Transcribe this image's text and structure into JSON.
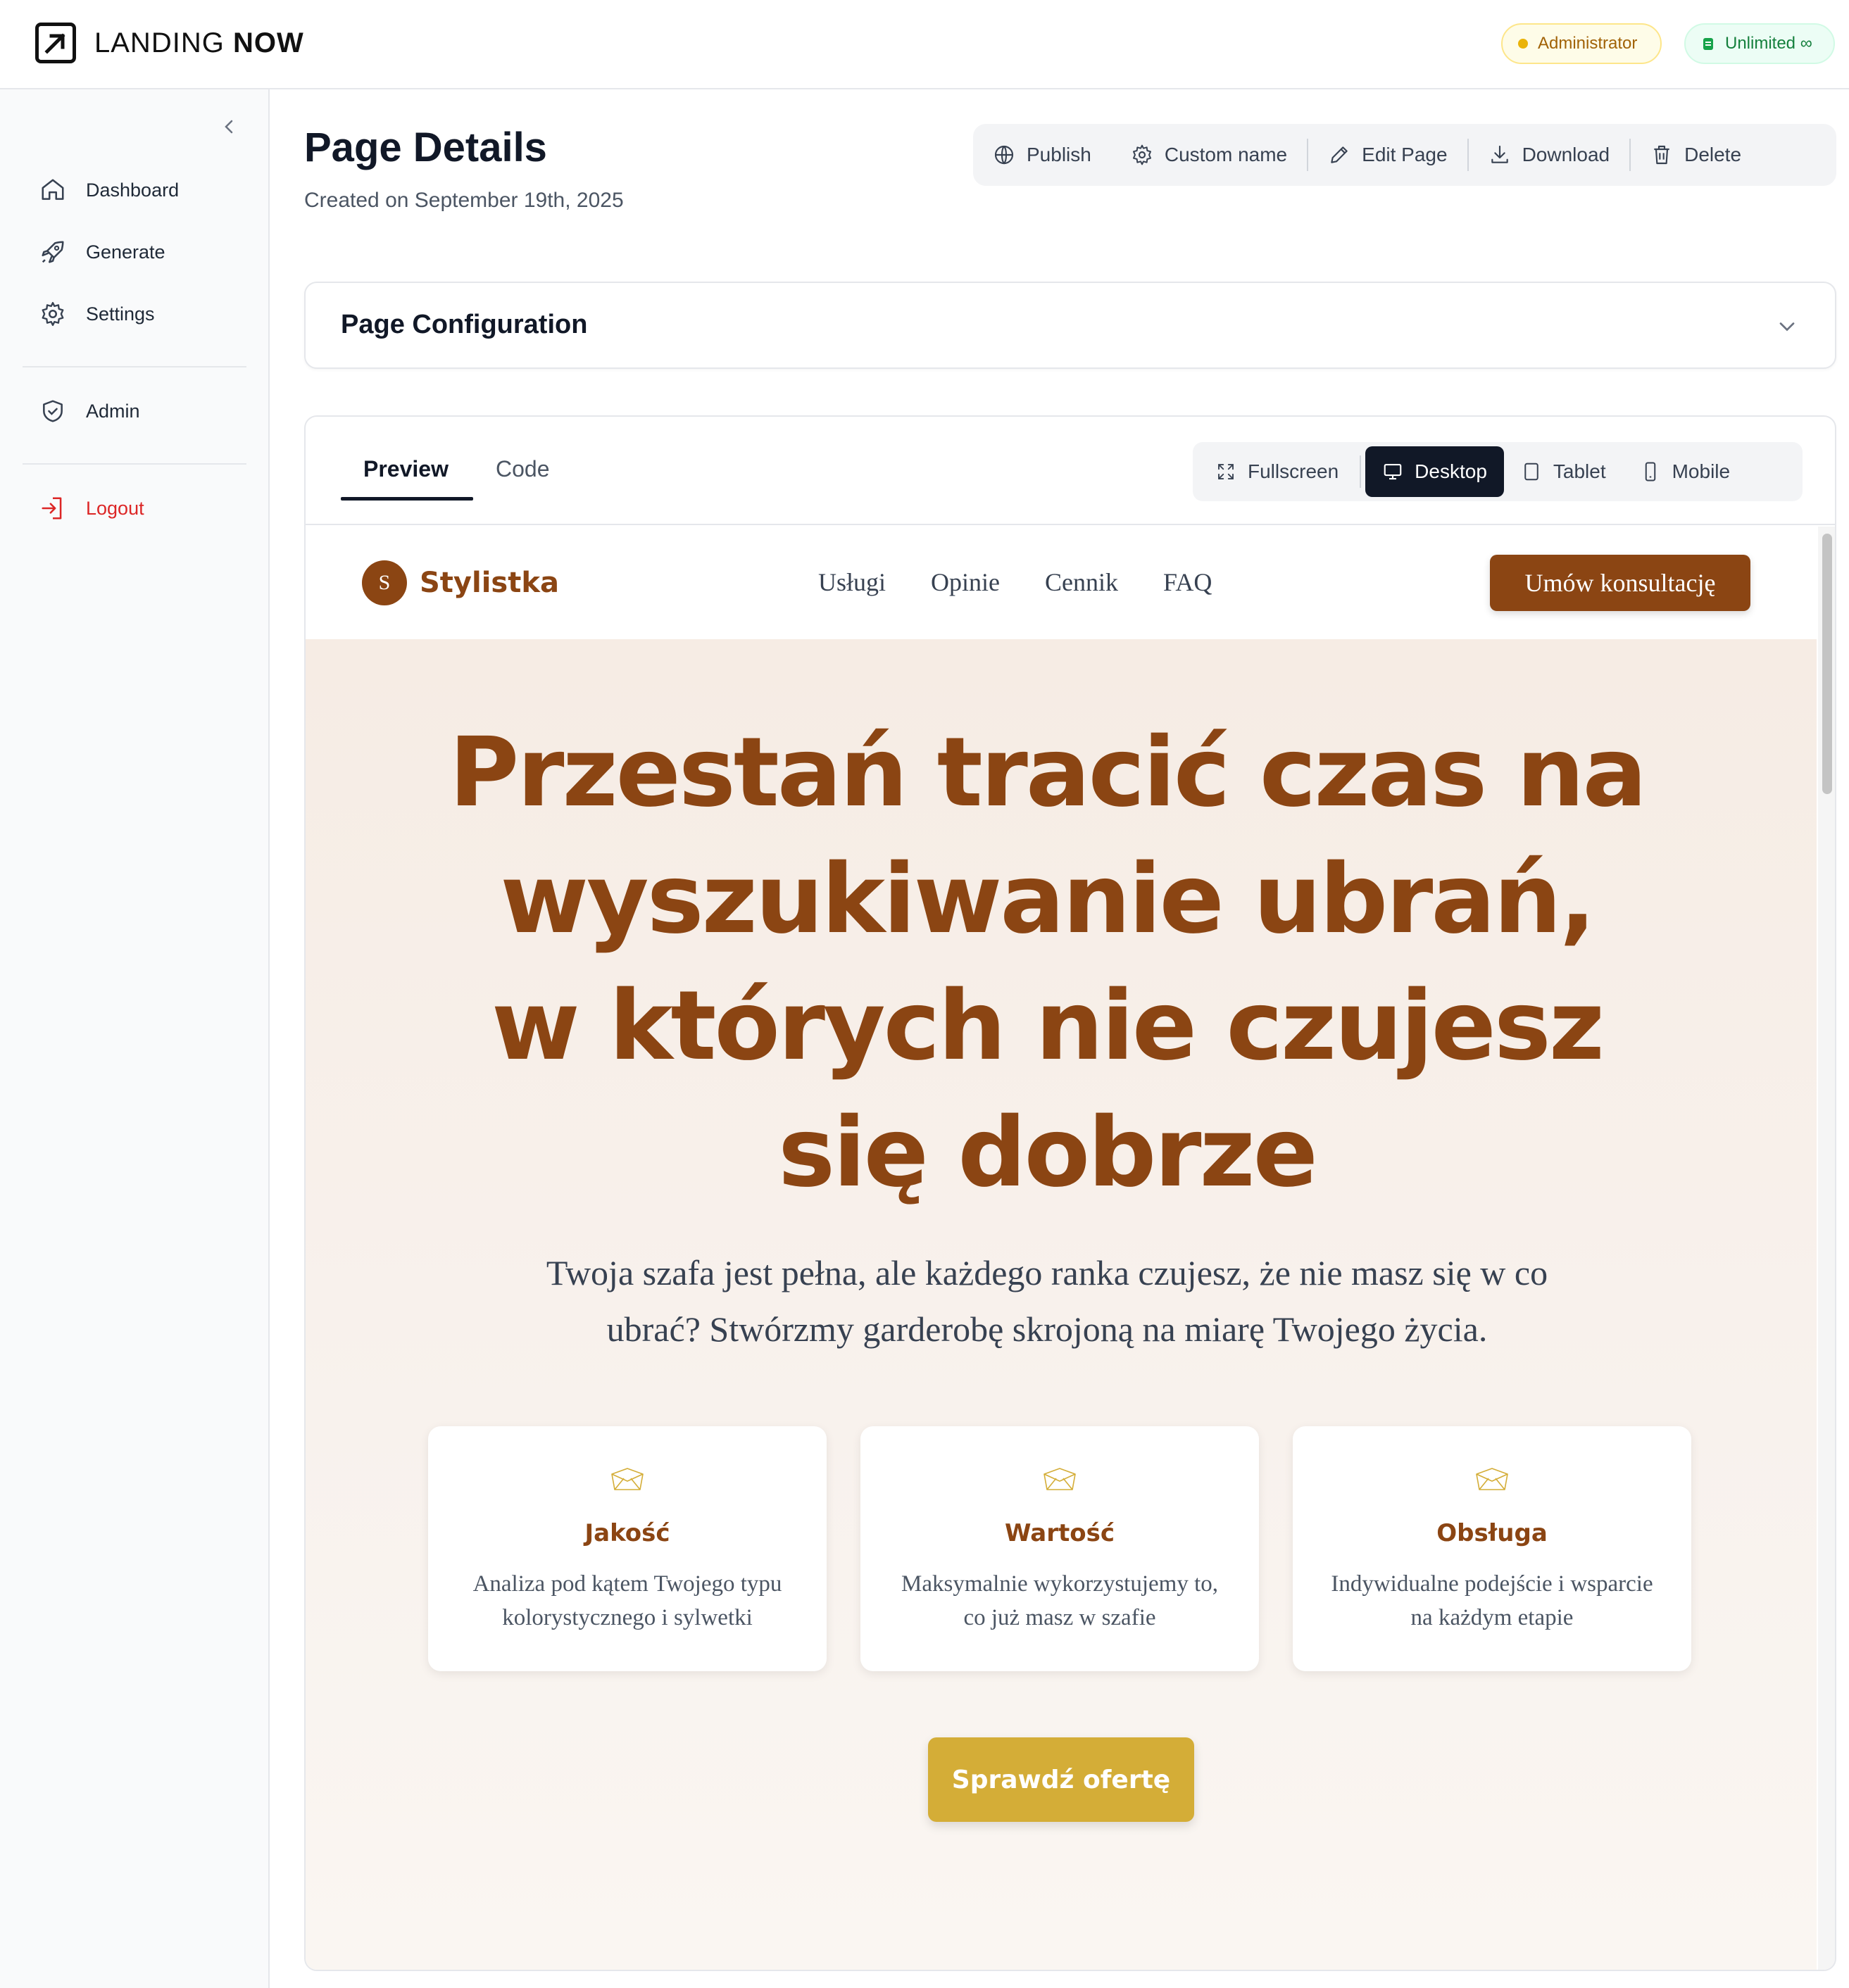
{
  "topbar": {
    "logo_light": "LANDING",
    "logo_bold": "NOW",
    "admin_badge": "Administrator",
    "plan_badge": "Unlimited ∞"
  },
  "sidebar": {
    "items": [
      {
        "label": "Dashboard",
        "icon": "home-icon"
      },
      {
        "label": "Generate",
        "icon": "rocket-icon"
      },
      {
        "label": "Settings",
        "icon": "gear-icon"
      },
      {
        "label": "Admin",
        "icon": "shield-icon"
      },
      {
        "label": "Logout",
        "icon": "logout-icon"
      }
    ]
  },
  "header": {
    "title": "Page Details",
    "subtitle": "Created on September 19th, 2025",
    "actions": {
      "publish": "Publish",
      "custom_name": "Custom name",
      "edit": "Edit Page",
      "download": "Download",
      "delete": "Delete"
    }
  },
  "config": {
    "title": "Page Configuration"
  },
  "preview": {
    "tabs": {
      "preview": "Preview",
      "code": "Code"
    },
    "views": {
      "fullscreen": "Fullscreen",
      "desktop": "Desktop",
      "tablet": "Tablet",
      "mobile": "Mobile"
    },
    "active_view": "Desktop"
  },
  "site": {
    "brand_initial": "S",
    "brand_name": "Stylistka",
    "links": [
      "Usługi",
      "Opinie",
      "Cennik",
      "FAQ"
    ],
    "cta": "Umów konsultację",
    "hero_title": "Przestań tracić czas na wyszukiwanie ubrań, w których nie czujesz się dobrze",
    "hero_sub": "Twoja szafa jest pełna, ale każdego ranka czujesz, że nie masz się w co ubrać? Stwórzmy garderobę skrojoną na miarę Twojego życia.",
    "features": [
      {
        "title": "Jakość",
        "text": "Analiza pod kątem Twojego typu kolorystycznego i sylwetki"
      },
      {
        "title": "Wartość",
        "text": "Maksymalnie wykorzystujemy to, co już masz w szafie"
      },
      {
        "title": "Obsługa",
        "text": "Indywidualne podejście i wsparcie na każdym etapie"
      }
    ],
    "offer_button": "Sprawdź ofertę",
    "colors": {
      "brand": "#8b4513",
      "accent": "#d4ad37",
      "hero_bg": "#f6ece4"
    }
  }
}
